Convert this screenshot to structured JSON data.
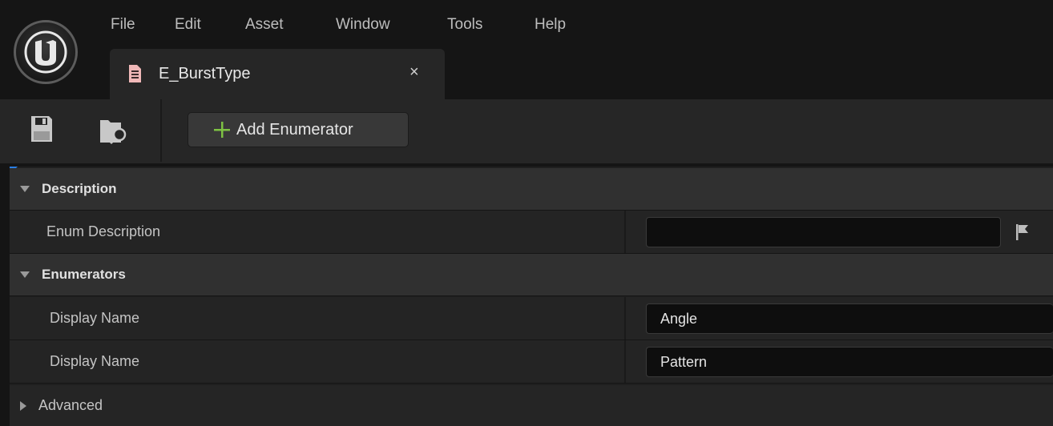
{
  "menu": {
    "items": [
      "File",
      "Edit",
      "Asset",
      "Window",
      "Tools",
      "Help"
    ]
  },
  "tab": {
    "title": "E_BurstType",
    "close_glyph": "×"
  },
  "toolbar": {
    "save_icon": "save-icon",
    "browse_icon": "browse-to-asset-icon",
    "add_enumerator_label": "Add Enumerator",
    "add_icon_color": "#7ec243"
  },
  "details": {
    "description_category": "Description",
    "enum_description_label": "Enum Description",
    "enum_description_value": "",
    "enumerators_category": "Enumerators",
    "enumerators": [
      {
        "label": "Display Name",
        "value": "Angle"
      },
      {
        "label": "Display Name",
        "value": "Pattern"
      }
    ],
    "advanced_label": "Advanced"
  },
  "colors": {
    "accent_blue": "#2a7fe5",
    "tab_icon": "#e8a0a0"
  }
}
